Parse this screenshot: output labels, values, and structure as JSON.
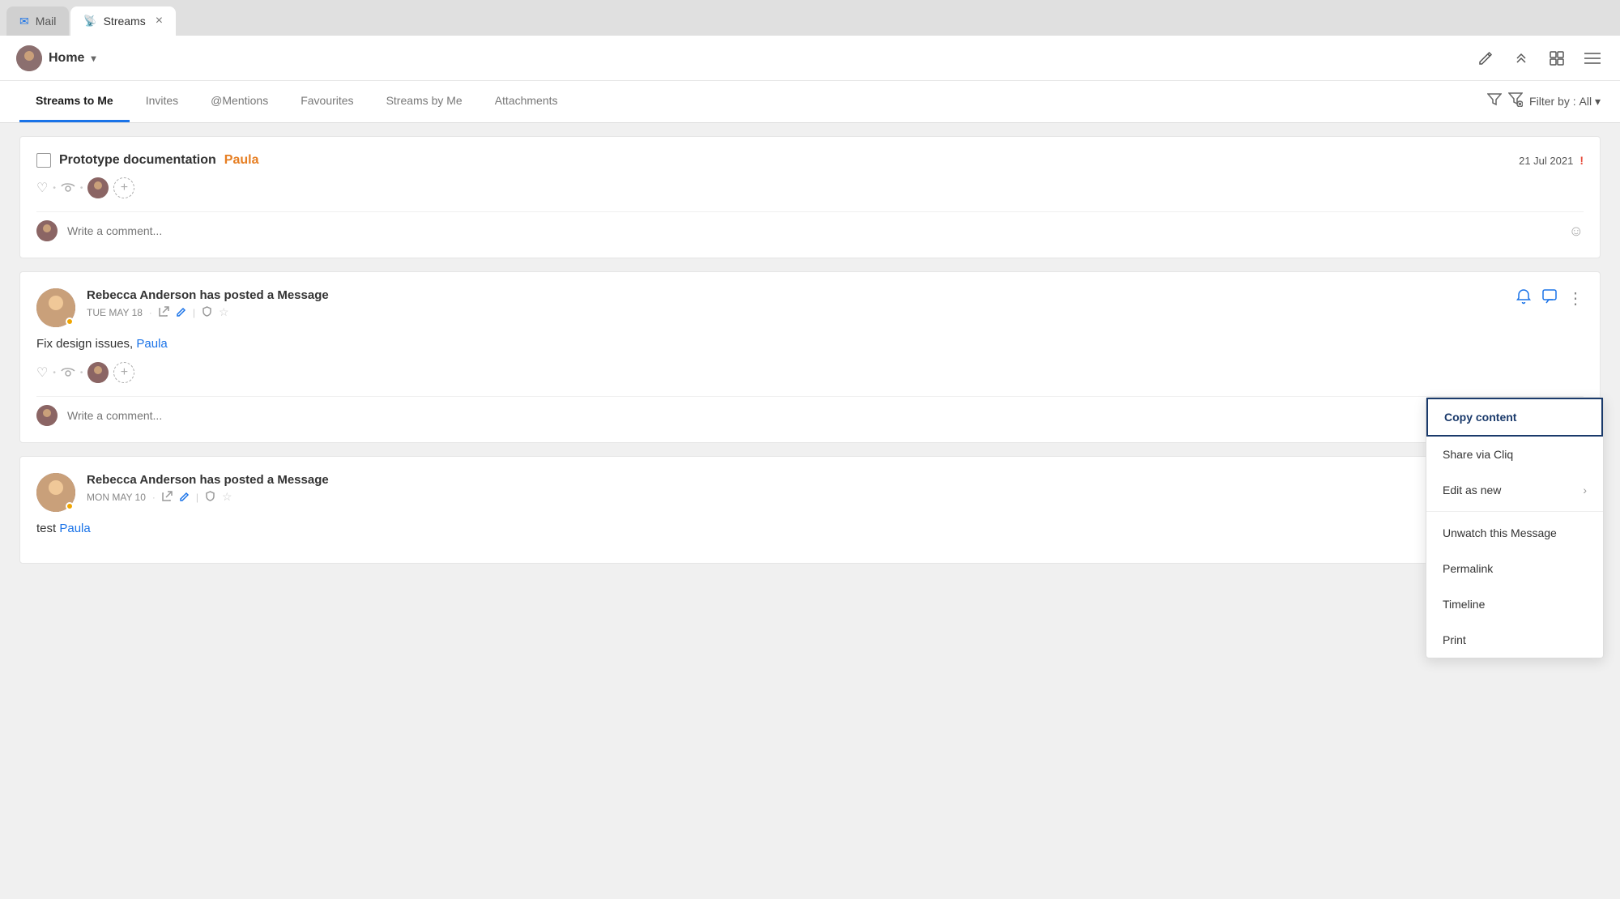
{
  "browser": {
    "tab_mail_label": "Mail",
    "tab_streams_label": "Streams",
    "tab_mail_icon": "✉",
    "tab_streams_icon": "📡"
  },
  "header": {
    "home_label": "Home",
    "compose_icon": "✏",
    "chevron_up_icon": "⌃",
    "grid_icon": "⊞",
    "menu_icon": "☰"
  },
  "tabs": {
    "items": [
      {
        "id": "streams-to-me",
        "label": "Streams to Me",
        "active": true
      },
      {
        "id": "invites",
        "label": "Invites",
        "active": false
      },
      {
        "id": "mentions",
        "label": "@Mentions",
        "active": false
      },
      {
        "id": "favourites",
        "label": "Favourites",
        "active": false
      },
      {
        "id": "streams-by-me",
        "label": "Streams by Me",
        "active": false
      },
      {
        "id": "attachments",
        "label": "Attachments",
        "active": false
      }
    ],
    "filter_label": "Filter by :",
    "filter_value": "All"
  },
  "card1": {
    "title": "Prototype documentation",
    "mention": "Paula",
    "date": "21 Jul 2021",
    "urgent": "!",
    "comment_placeholder": "Write a comment..."
  },
  "card2": {
    "author": "Rebecca Anderson has posted a Message",
    "date": "TUE MAY 18",
    "body": "Fix design issues,",
    "mention": "Paula",
    "comment_placeholder": "Write a comment..."
  },
  "card3": {
    "author": "Rebecca Anderson has posted a Message",
    "date": "MON MAY 10",
    "body": "test",
    "mention": "Paula"
  },
  "context_menu": {
    "items": [
      {
        "id": "copy-content",
        "label": "Copy content",
        "active": true,
        "has_arrow": false
      },
      {
        "id": "share-via-cliq",
        "label": "Share via Cliq",
        "active": false,
        "has_arrow": false
      },
      {
        "id": "edit-as-new",
        "label": "Edit as new",
        "active": false,
        "has_arrow": true
      },
      {
        "id": "divider1",
        "type": "divider"
      },
      {
        "id": "unwatch",
        "label": "Unwatch this Message",
        "active": false,
        "has_arrow": false
      },
      {
        "id": "permalink",
        "label": "Permalink",
        "active": false,
        "has_arrow": false
      },
      {
        "id": "timeline",
        "label": "Timeline",
        "active": false,
        "has_arrow": false
      },
      {
        "id": "print",
        "label": "Print",
        "active": false,
        "has_arrow": false
      }
    ]
  }
}
